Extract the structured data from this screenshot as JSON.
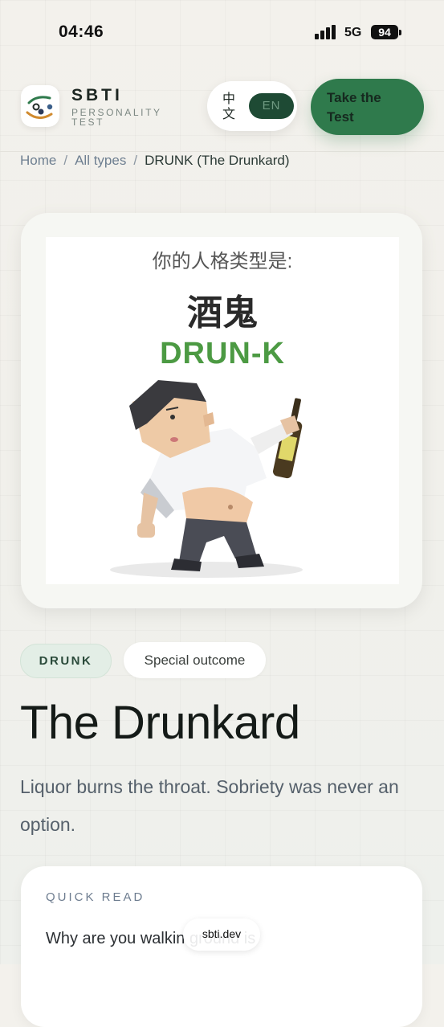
{
  "status_bar": {
    "time": "04:46",
    "network": "5G",
    "battery": "94"
  },
  "header": {
    "brand_name": "SBTI",
    "brand_sub": "PERSONALITY TEST",
    "lang_zh": "中文",
    "lang_en": "EN",
    "cta_label": "Take the Test"
  },
  "breadcrumb": {
    "items": [
      "Home",
      "All types"
    ],
    "current": "DRUNK (The Drunkard)"
  },
  "hero": {
    "question": "你的人格类型是:",
    "type_zh": "酒鬼",
    "type_code": "DRUN-K"
  },
  "tags": {
    "code": "DRUNK",
    "special": "Special outcome"
  },
  "title": "The Drunkard",
  "tagline": "Liquor burns the throat. Sobriety was never an option.",
  "quick_read": {
    "label": "QUICK READ",
    "text": "Why are you walkin ground is"
  },
  "domain_pill": "sbti.dev",
  "icons": {
    "signal": "signal-bars-icon",
    "battery": "battery-icon",
    "logo": "sbti-logo-icon"
  },
  "colors": {
    "accent": "#2f7a4c",
    "accent_dark": "#1e4a34",
    "type_code_green": "#4c9a43"
  }
}
